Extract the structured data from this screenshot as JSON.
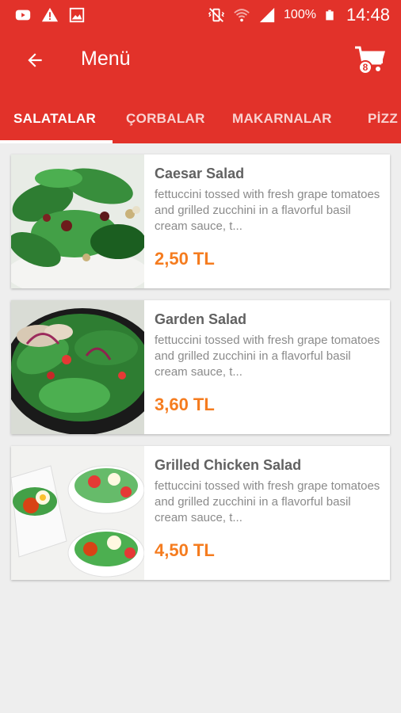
{
  "status_bar": {
    "battery": "100%",
    "time": "14:48",
    "icons": [
      "youtube-icon",
      "warning-icon",
      "gallery-icon",
      "vibrate-icon",
      "wifi-icon",
      "signal-icon",
      "battery-icon"
    ]
  },
  "toolbar": {
    "title": "Menü",
    "cart_count": "8"
  },
  "tabs": [
    {
      "label": "SALATALAR"
    },
    {
      "label": "ÇORBALAR"
    },
    {
      "label": "MAKARNALAR"
    },
    {
      "label": "PİZZ"
    }
  ],
  "products": [
    {
      "name": "Caesar Salad",
      "description": "fettuccini tossed with fresh grape tomatoes and grilled zucchini in a flavorful basil cream sauce, t...",
      "price": "2,50 TL"
    },
    {
      "name": "Garden Salad",
      "description": "fettuccini tossed with fresh grape tomatoes and grilled zucchini in a flavorful basil cream sauce, t...",
      "price": "3,60 TL"
    },
    {
      "name": "Grilled Chicken Salad",
      "description": "fettuccini tossed with fresh grape tomatoes and grilled zucchini in a flavorful basil cream sauce, t...",
      "price": "4,50 TL"
    }
  ],
  "colors": {
    "primary": "#e2322a",
    "price": "#f57c1f",
    "background": "#eeeeee"
  }
}
